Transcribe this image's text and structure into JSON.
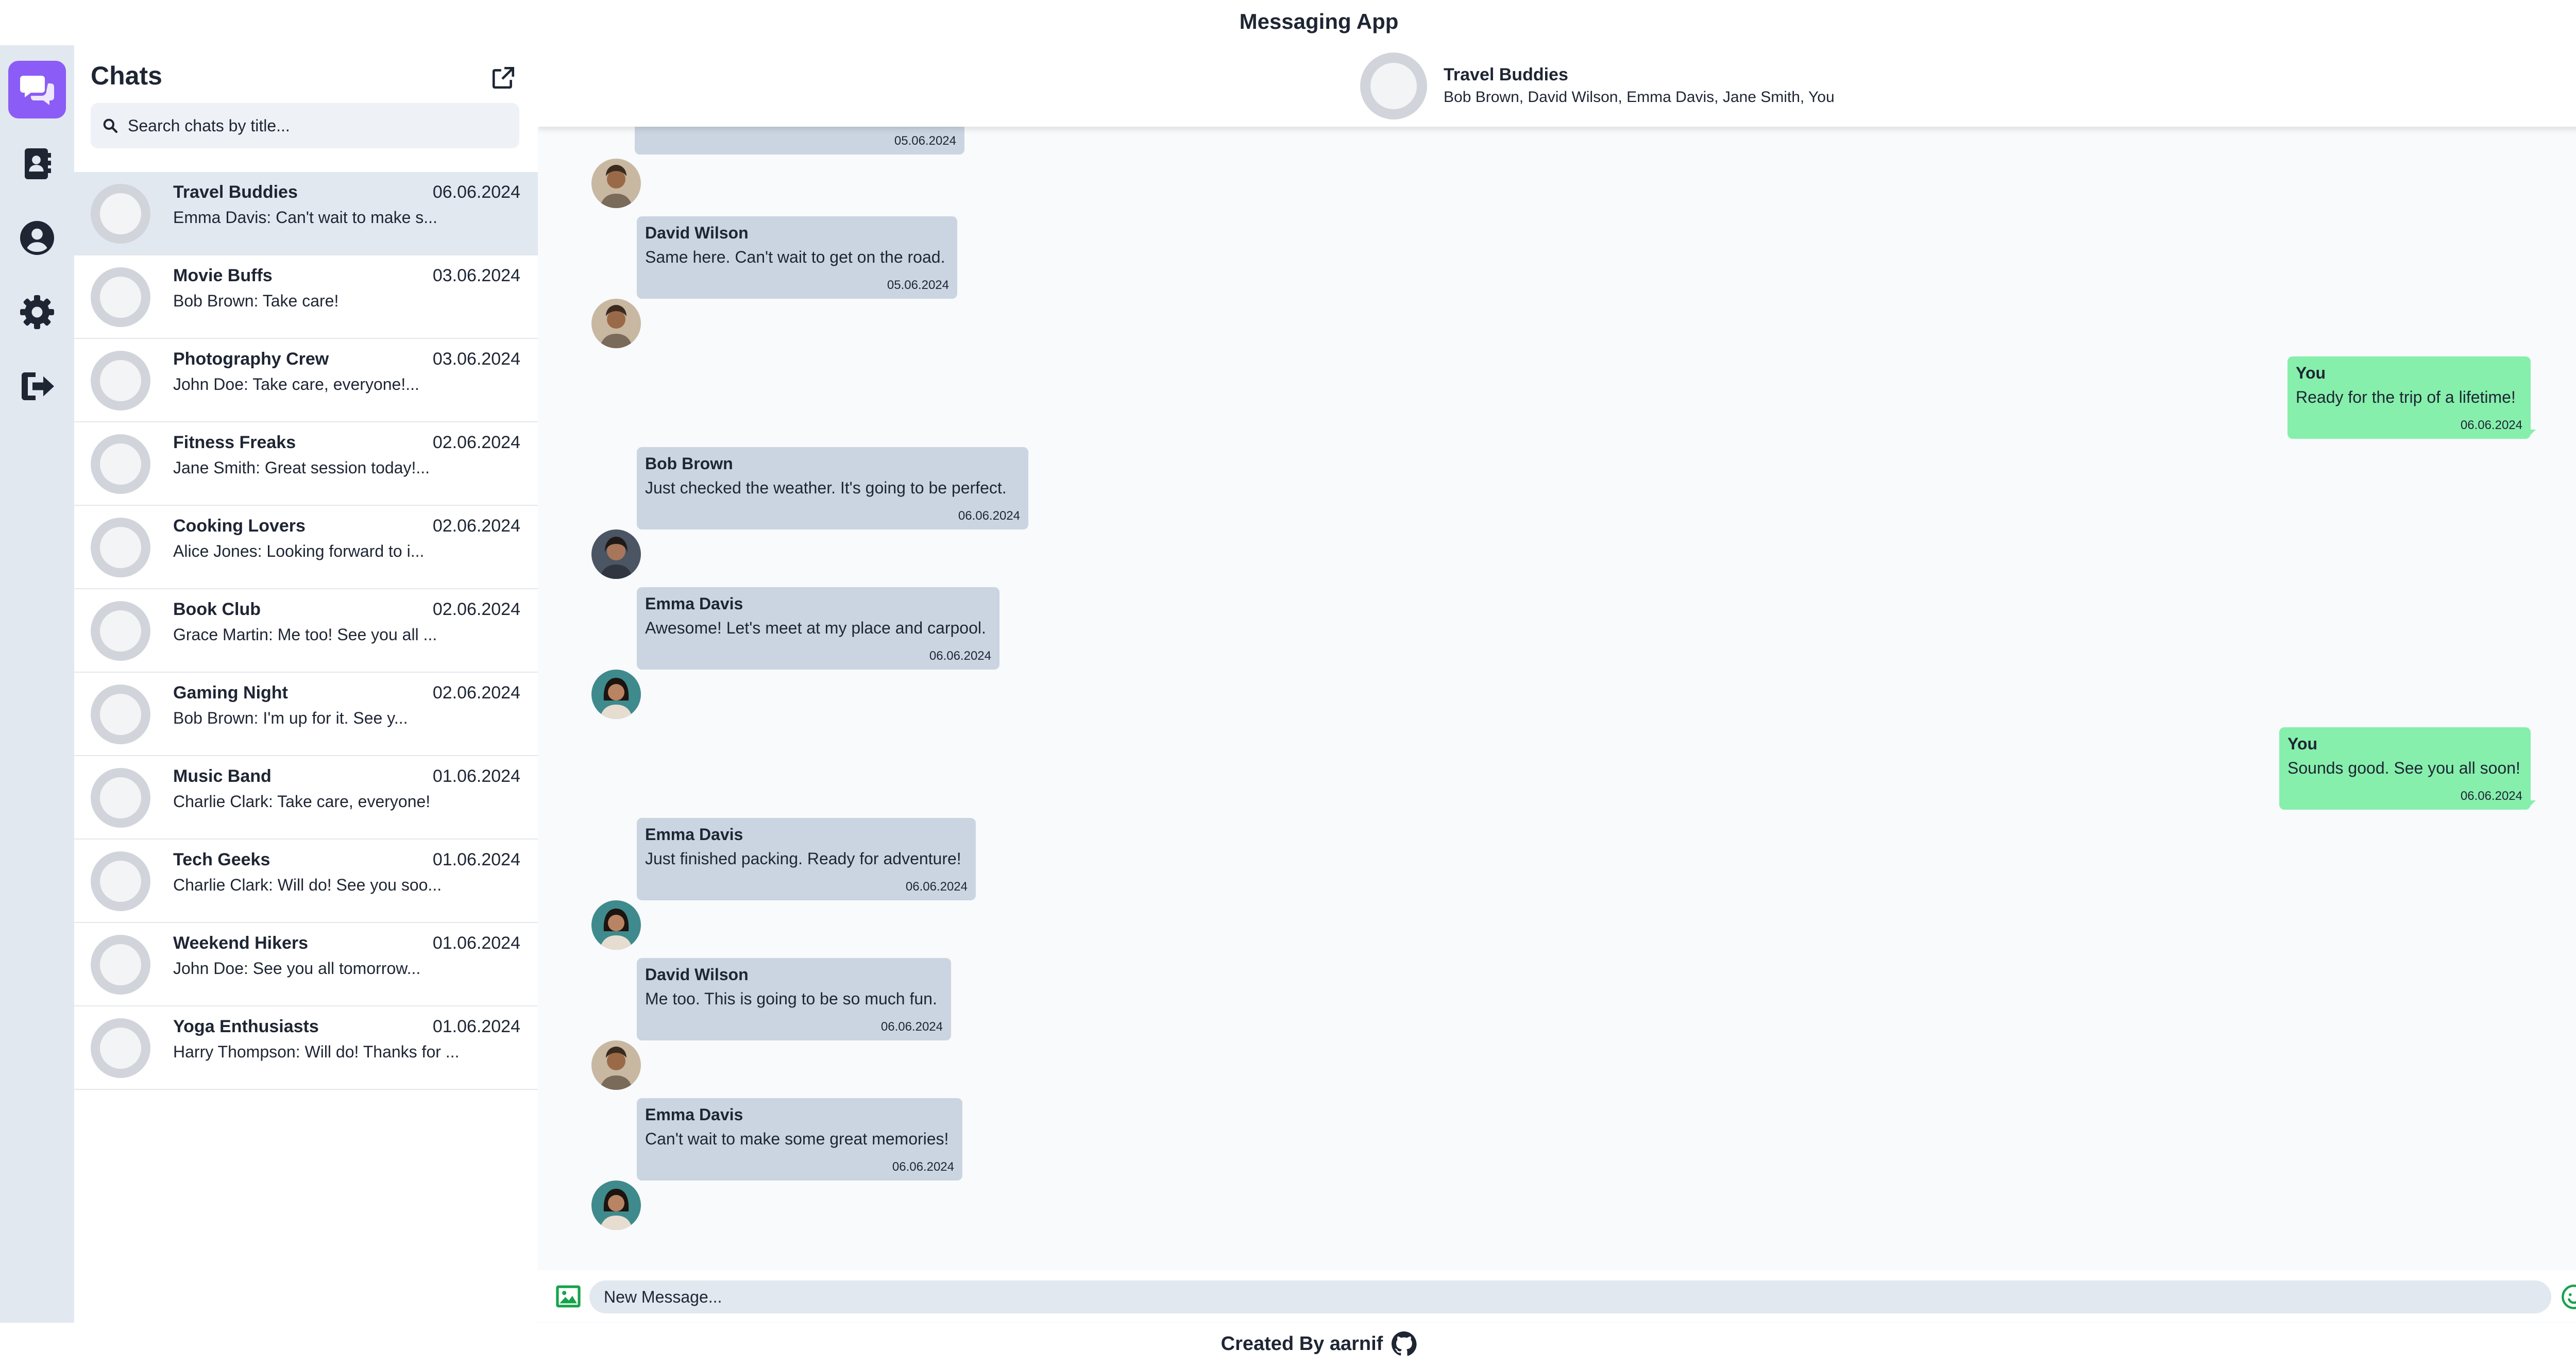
{
  "app": {
    "title": "Messaging App"
  },
  "footer": {
    "text": "Created By aarnif",
    "icon": "github-icon"
  },
  "colors": {
    "accent": "#8b5cf6",
    "incoming_bubble": "#cbd5e1",
    "outgoing_bubble": "#86efac",
    "action": "#16a34a"
  },
  "rail": {
    "items": [
      "chats-icon",
      "contacts-icon",
      "profile-icon",
      "settings-icon",
      "logout-icon"
    ],
    "active": "chats-icon"
  },
  "sidebar": {
    "title": "Chats",
    "search_placeholder": "Search chats by title...",
    "chats": [
      {
        "name": "Travel Buddies",
        "date": "06.06.2024",
        "preview": "Emma Davis: Can't wait to make s..."
      },
      {
        "name": "Movie Buffs",
        "date": "03.06.2024",
        "preview": "Bob Brown: Take care!"
      },
      {
        "name": "Photography Crew",
        "date": "03.06.2024",
        "preview": "John Doe: Take care, everyone!..."
      },
      {
        "name": "Fitness Freaks",
        "date": "02.06.2024",
        "preview": "Jane Smith: Great session today!..."
      },
      {
        "name": "Cooking Lovers",
        "date": "02.06.2024",
        "preview": "Alice Jones: Looking forward to i..."
      },
      {
        "name": "Book Club",
        "date": "02.06.2024",
        "preview": "Grace Martin: Me too! See you all ..."
      },
      {
        "name": "Gaming Night",
        "date": "02.06.2024",
        "preview": "Bob Brown: I'm up for it. See y..."
      },
      {
        "name": "Music Band",
        "date": "01.06.2024",
        "preview": "Charlie Clark: Take care, everyone!"
      },
      {
        "name": "Tech Geeks",
        "date": "01.06.2024",
        "preview": "Charlie Clark: Will do! See you soo..."
      },
      {
        "name": "Weekend Hikers",
        "date": "01.06.2024",
        "preview": "John Doe: See you all tomorrow..."
      },
      {
        "name": "Yoga Enthusiasts",
        "date": "01.06.2024",
        "preview": "Harry Thompson: Will do! Thanks for ..."
      }
    ]
  },
  "chat": {
    "title": "Travel Buddies",
    "members": "Bob Brown, David Wilson, Emma Davis, Jane Smith, You",
    "messages": [
      {
        "sender": "",
        "text": "",
        "time": "05.06.2024",
        "outgoing": false
      },
      {
        "sender": "David Wilson",
        "text": "Same here. Can't wait to get on the road.",
        "time": "05.06.2024",
        "outgoing": false
      },
      {
        "sender": "You",
        "text": "Ready for the trip of a lifetime!",
        "time": "06.06.2024",
        "outgoing": true
      },
      {
        "sender": "Bob Brown",
        "text": "Just checked the weather. It's going to be perfect.",
        "time": "06.06.2024",
        "outgoing": false
      },
      {
        "sender": "Emma Davis",
        "text": "Awesome! Let's meet at my place and carpool.",
        "time": "06.06.2024",
        "outgoing": false
      },
      {
        "sender": "You",
        "text": "Sounds good. See you all soon!",
        "time": "06.06.2024",
        "outgoing": true
      },
      {
        "sender": "Emma Davis",
        "text": "Just finished packing. Ready for adventure!",
        "time": "06.06.2024",
        "outgoing": false
      },
      {
        "sender": "David Wilson",
        "text": "Me too. This is going to be so much fun.",
        "time": "06.06.2024",
        "outgoing": false
      },
      {
        "sender": "Emma Davis",
        "text": "Can't wait to make some great memories!",
        "time": "06.06.2024",
        "outgoing": false
      }
    ],
    "composer_placeholder": "New Message..."
  }
}
